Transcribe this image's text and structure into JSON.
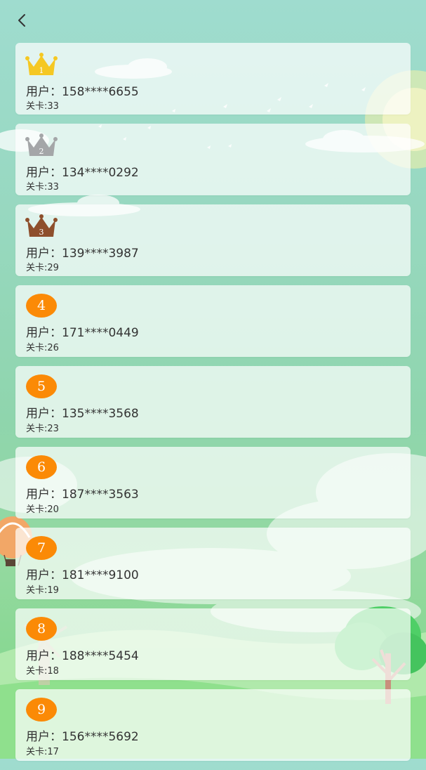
{
  "header": {
    "back_icon": "chevron-left-icon"
  },
  "colors": {
    "gold": "#f5c823",
    "silver": "#a4a6a8",
    "bronze": "#8e4f2c",
    "rank_badge": "#fb8a06",
    "card_bg": "rgba(255,255,255,0.70)",
    "text": "#333333"
  },
  "ranking": [
    {
      "rank": "1",
      "badge": "crown-gold-icon",
      "user_label": "用户：",
      "user_id": "158****6655",
      "level_label": "关卡:",
      "level": "33"
    },
    {
      "rank": "2",
      "badge": "crown-silver-icon",
      "user_label": "用户：",
      "user_id": "134****0292",
      "level_label": "关卡:",
      "level": "33"
    },
    {
      "rank": "3",
      "badge": "crown-bronze-icon",
      "user_label": "用户：",
      "user_id": "139****3987",
      "level_label": "关卡:",
      "level": "29"
    },
    {
      "rank": "4",
      "badge": "rank-circle",
      "user_label": "用户：",
      "user_id": "171****0449",
      "level_label": "关卡:",
      "level": "26"
    },
    {
      "rank": "5",
      "badge": "rank-circle",
      "user_label": "用户：",
      "user_id": "135****3568",
      "level_label": "关卡:",
      "level": "23"
    },
    {
      "rank": "6",
      "badge": "rank-circle",
      "user_label": "用户：",
      "user_id": "187****3563",
      "level_label": "关卡:",
      "level": "20"
    },
    {
      "rank": "7",
      "badge": "rank-circle",
      "user_label": "用户：",
      "user_id": "181****9100",
      "level_label": "关卡:",
      "level": "19"
    },
    {
      "rank": "8",
      "badge": "rank-circle",
      "user_label": "用户：",
      "user_id": "188****5454",
      "level_label": "关卡:",
      "level": "18"
    },
    {
      "rank": "9",
      "badge": "rank-circle",
      "user_label": "用户：",
      "user_id": "156****5692",
      "level_label": "关卡:",
      "level": "17"
    }
  ]
}
